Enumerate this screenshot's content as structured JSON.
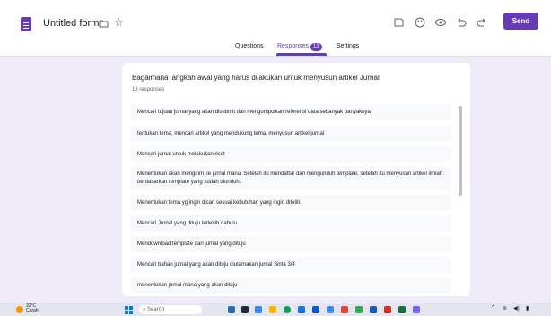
{
  "header": {
    "title": "Untitled form",
    "send_label": "Send",
    "tabs": [
      {
        "label": "Questions"
      },
      {
        "label": "Responses",
        "badge": "13"
      },
      {
        "label": "Settings"
      }
    ]
  },
  "question": {
    "title": "Bagaimana langkah awal yang harus dilakukan untuk menyusun artikel Jurnal",
    "response_count": "13 responses",
    "responses": [
      "Mencari tujuan jurnal yang akan disubmit dan mengumpulkan referensi data sebanyak banyaknya",
      "tentukan tema, mencari artikel yang mendukung tema, menyusun artikel jurnal",
      "Mencari jurnal untuk melakukan riset",
      "Menentukan akan mengirim ke jurnal mana. Setelah itu mendaftar dan mengunduh template, setelah itu menyusun artikel ilmiah berdasarkan template yang sudah diunduh.",
      "Menentukan tema yg ingin dicari sesuai kebutuhan yang ingin diteliti.",
      "Mencari Jurnal yang dituju terlebih dahulu",
      "Mendownload template dari jurnal yang dituju",
      "Mencari bahan jurnal yang akan dituju diutamakan jurnal Sinta 3/4",
      "menentukan jurnal mana yang akan dituju"
    ]
  },
  "taskbar": {
    "weather_temp": "32°C",
    "weather_desc": "Cerah",
    "search_placeholder": "Search"
  },
  "colors": {
    "accent": "#673ab7",
    "background": "#f0ebf8"
  }
}
